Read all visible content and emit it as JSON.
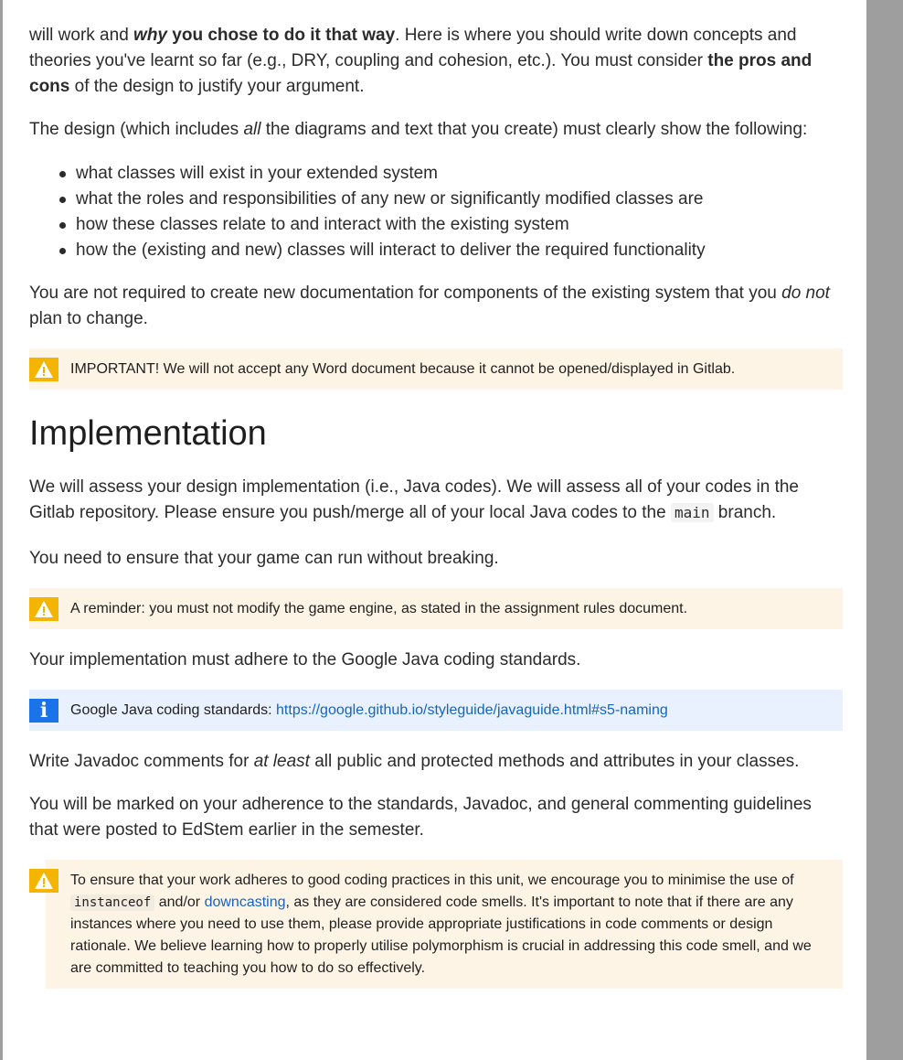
{
  "design": {
    "para1": {
      "t1": "will work and ",
      "em1": "why",
      "b1": " you chose to do it that way",
      "t2": ".  Here is where you should write down concepts and theories you've learnt so far (e.g., DRY, coupling and cohesion, etc.). You must consider ",
      "b2": "the pros and cons",
      "t3": " of the design to justify your argument."
    },
    "para2": {
      "t1": "The design (which includes ",
      "em": "all",
      "t2": " the diagrams and text that you create) must clearly show the following:"
    },
    "bullets": [
      "what classes will exist in your extended system",
      "what the roles and responsibilities of any new or significantly modified classes are",
      "how these classes relate to and interact with the existing system",
      "how the (existing and new) classes will interact to deliver the required functionality"
    ],
    "para3": {
      "t1": "You are not required to create new documentation for components of the existing system that you ",
      "em": "do not",
      "t2": " plan to change."
    },
    "warning1": "IMPORTANT! We will not accept any Word document because it cannot be opened/displayed in Gitlab."
  },
  "implementation": {
    "heading": "Implementation",
    "para1": {
      "t1": "We will assess your design implementation (i.e., Java codes). We will assess all of your codes in the Gitlab repository. Please ensure you push/merge all of your local Java codes to the ",
      "code": "main",
      "t2": " branch."
    },
    "para2": "You need to ensure that your game can run without breaking.",
    "warning2": "A reminder: you must not modify the game engine, as stated in the assignment rules document.",
    "para3": "Your implementation must adhere to the Google Java coding standards.",
    "info": {
      "label": "Google Java coding standards: ",
      "link": "https://google.github.io/styleguide/javaguide.html#s5-naming"
    },
    "para4": {
      "t1": "Write Javadoc comments for ",
      "em": "at least",
      "t2": " all public and protected methods and attributes in your classes."
    },
    "para5": "You will be marked on your adherence to the standards, Javadoc, and general commenting guidelines that were posted to EdStem earlier in the semester.",
    "warning3": {
      "t1": "To ensure that your work adheres to good coding practices in this unit, we encourage you to minimise the use of ",
      "code": "instanceof",
      "t2": " and/or ",
      "link": "downcasting",
      "t3": ", as they are considered code smells. It's important to note that if there are any instances where you need to use them, please provide appropriate justifications in code comments or design rationale. We believe learning how to properly utilise polymorphism is crucial in addressing this code smell, and we are committed to teaching you how to do so effectively."
    }
  },
  "icons": {
    "warning": "warning-triangle-icon",
    "info": "info-icon"
  },
  "colors": {
    "warning_bg": "#fdf4e5",
    "warning_icon": "#f5b400",
    "info_bg": "#e8f1fd",
    "info_icon": "#1a73e8",
    "link": "#1565c0",
    "scrollbar": "#9e9e9e"
  }
}
